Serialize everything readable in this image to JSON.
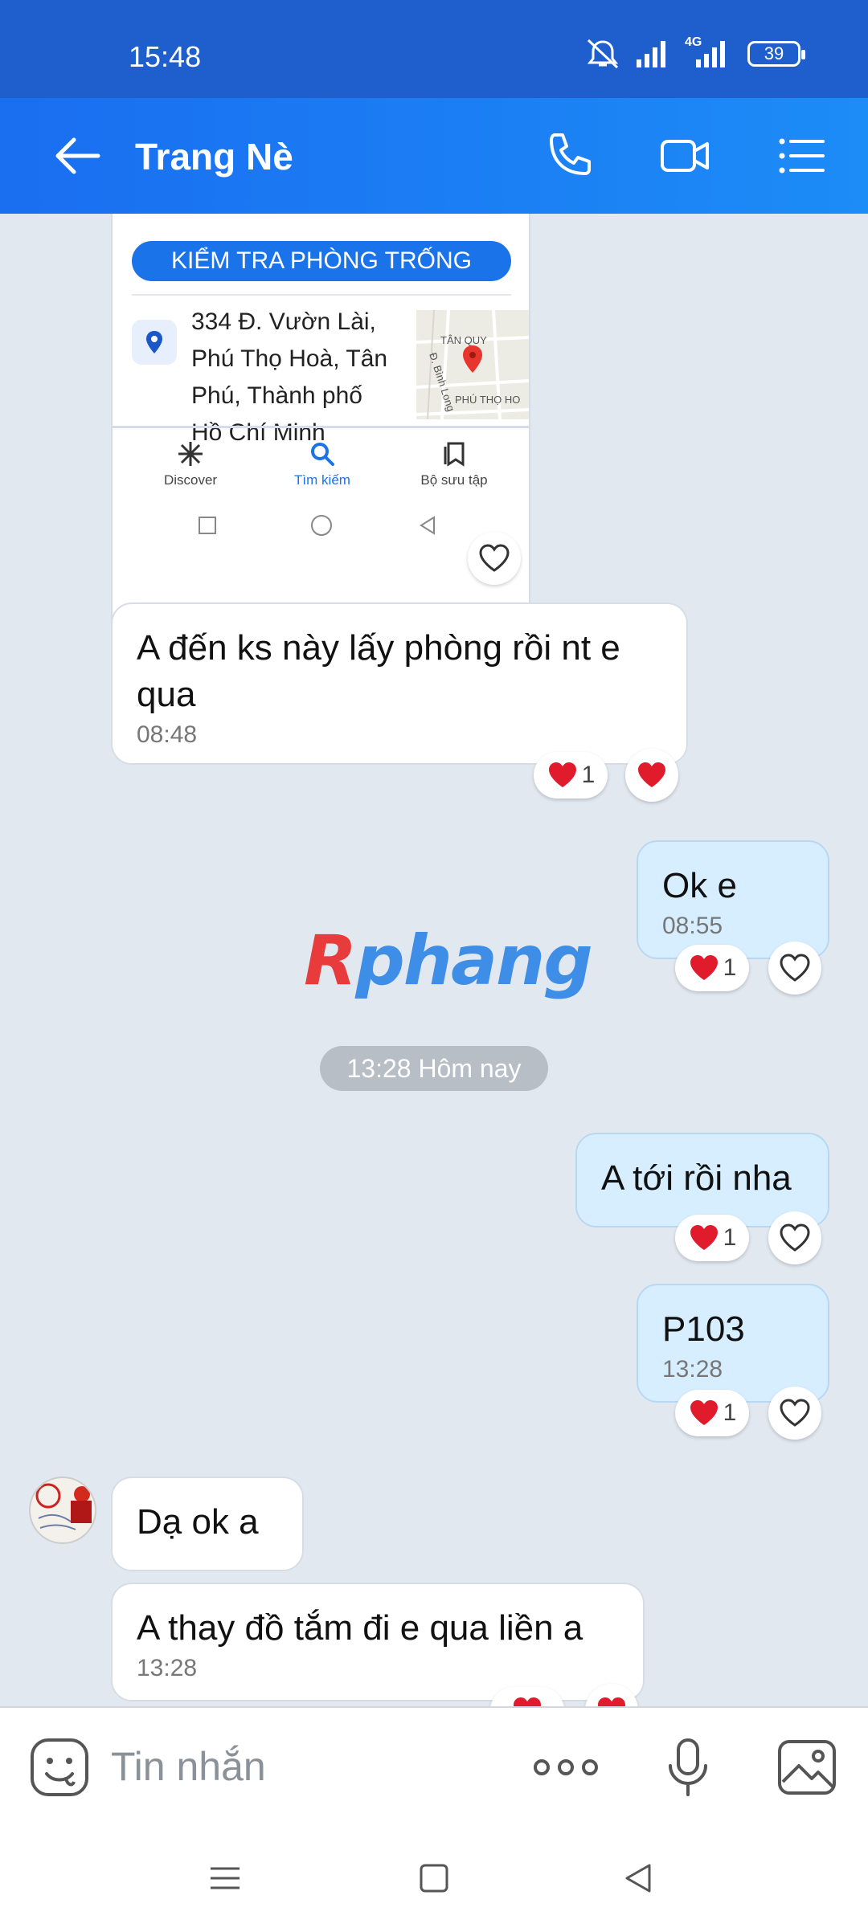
{
  "status_bar": {
    "time": "15:48",
    "battery": "39",
    "network": "4G"
  },
  "header": {
    "title": "Trang Nè"
  },
  "shared_card": {
    "check_button": "KIỂM TRA PHÒNG TRỐNG",
    "address_lines": [
      "334 Đ. Vườn Lài,",
      "Phú Thọ Hoà, Tân",
      "Phú, Thành phố",
      "Hồ Chí Minh"
    ],
    "map_labels": {
      "area1": "TÂN QUY",
      "street": "Đ. Bình Long",
      "area2": "PHÚ THỌ HO"
    },
    "nav": {
      "discover": "Discover",
      "search": "Tìm kiếm",
      "collection": "Bộ sưu tập"
    }
  },
  "messages": [
    {
      "direction": "in",
      "text": "A đến ks này lấy phòng rồi nt e qua",
      "time": "08:48",
      "reaction_count": "1"
    },
    {
      "direction": "out",
      "text": "Ok e",
      "time": "08:55",
      "reaction_count": "1"
    },
    {
      "direction": "out",
      "text": "A tới rồi nha",
      "time": "",
      "reaction_count": "1"
    },
    {
      "direction": "out",
      "text": "P103",
      "time": "13:28",
      "reaction_count": "1"
    },
    {
      "direction": "in",
      "text": "Dạ ok a",
      "time": ""
    },
    {
      "direction": "in",
      "text": "A thay đồ tắm đi e qua liền a",
      "time": "13:28"
    }
  ],
  "date_separator": "13:28 Hôm nay",
  "watermark": {
    "first": "R",
    "rest": "phang"
  },
  "input": {
    "placeholder": "Tin nhắn"
  },
  "colors": {
    "header": "#1a6ef0",
    "status_bar": "#1f5fcd",
    "outgoing_bubble": "#d6eeff",
    "incoming_bubble": "#ffffff",
    "background": "#e2e8f0",
    "heart": "#e01b2b"
  }
}
